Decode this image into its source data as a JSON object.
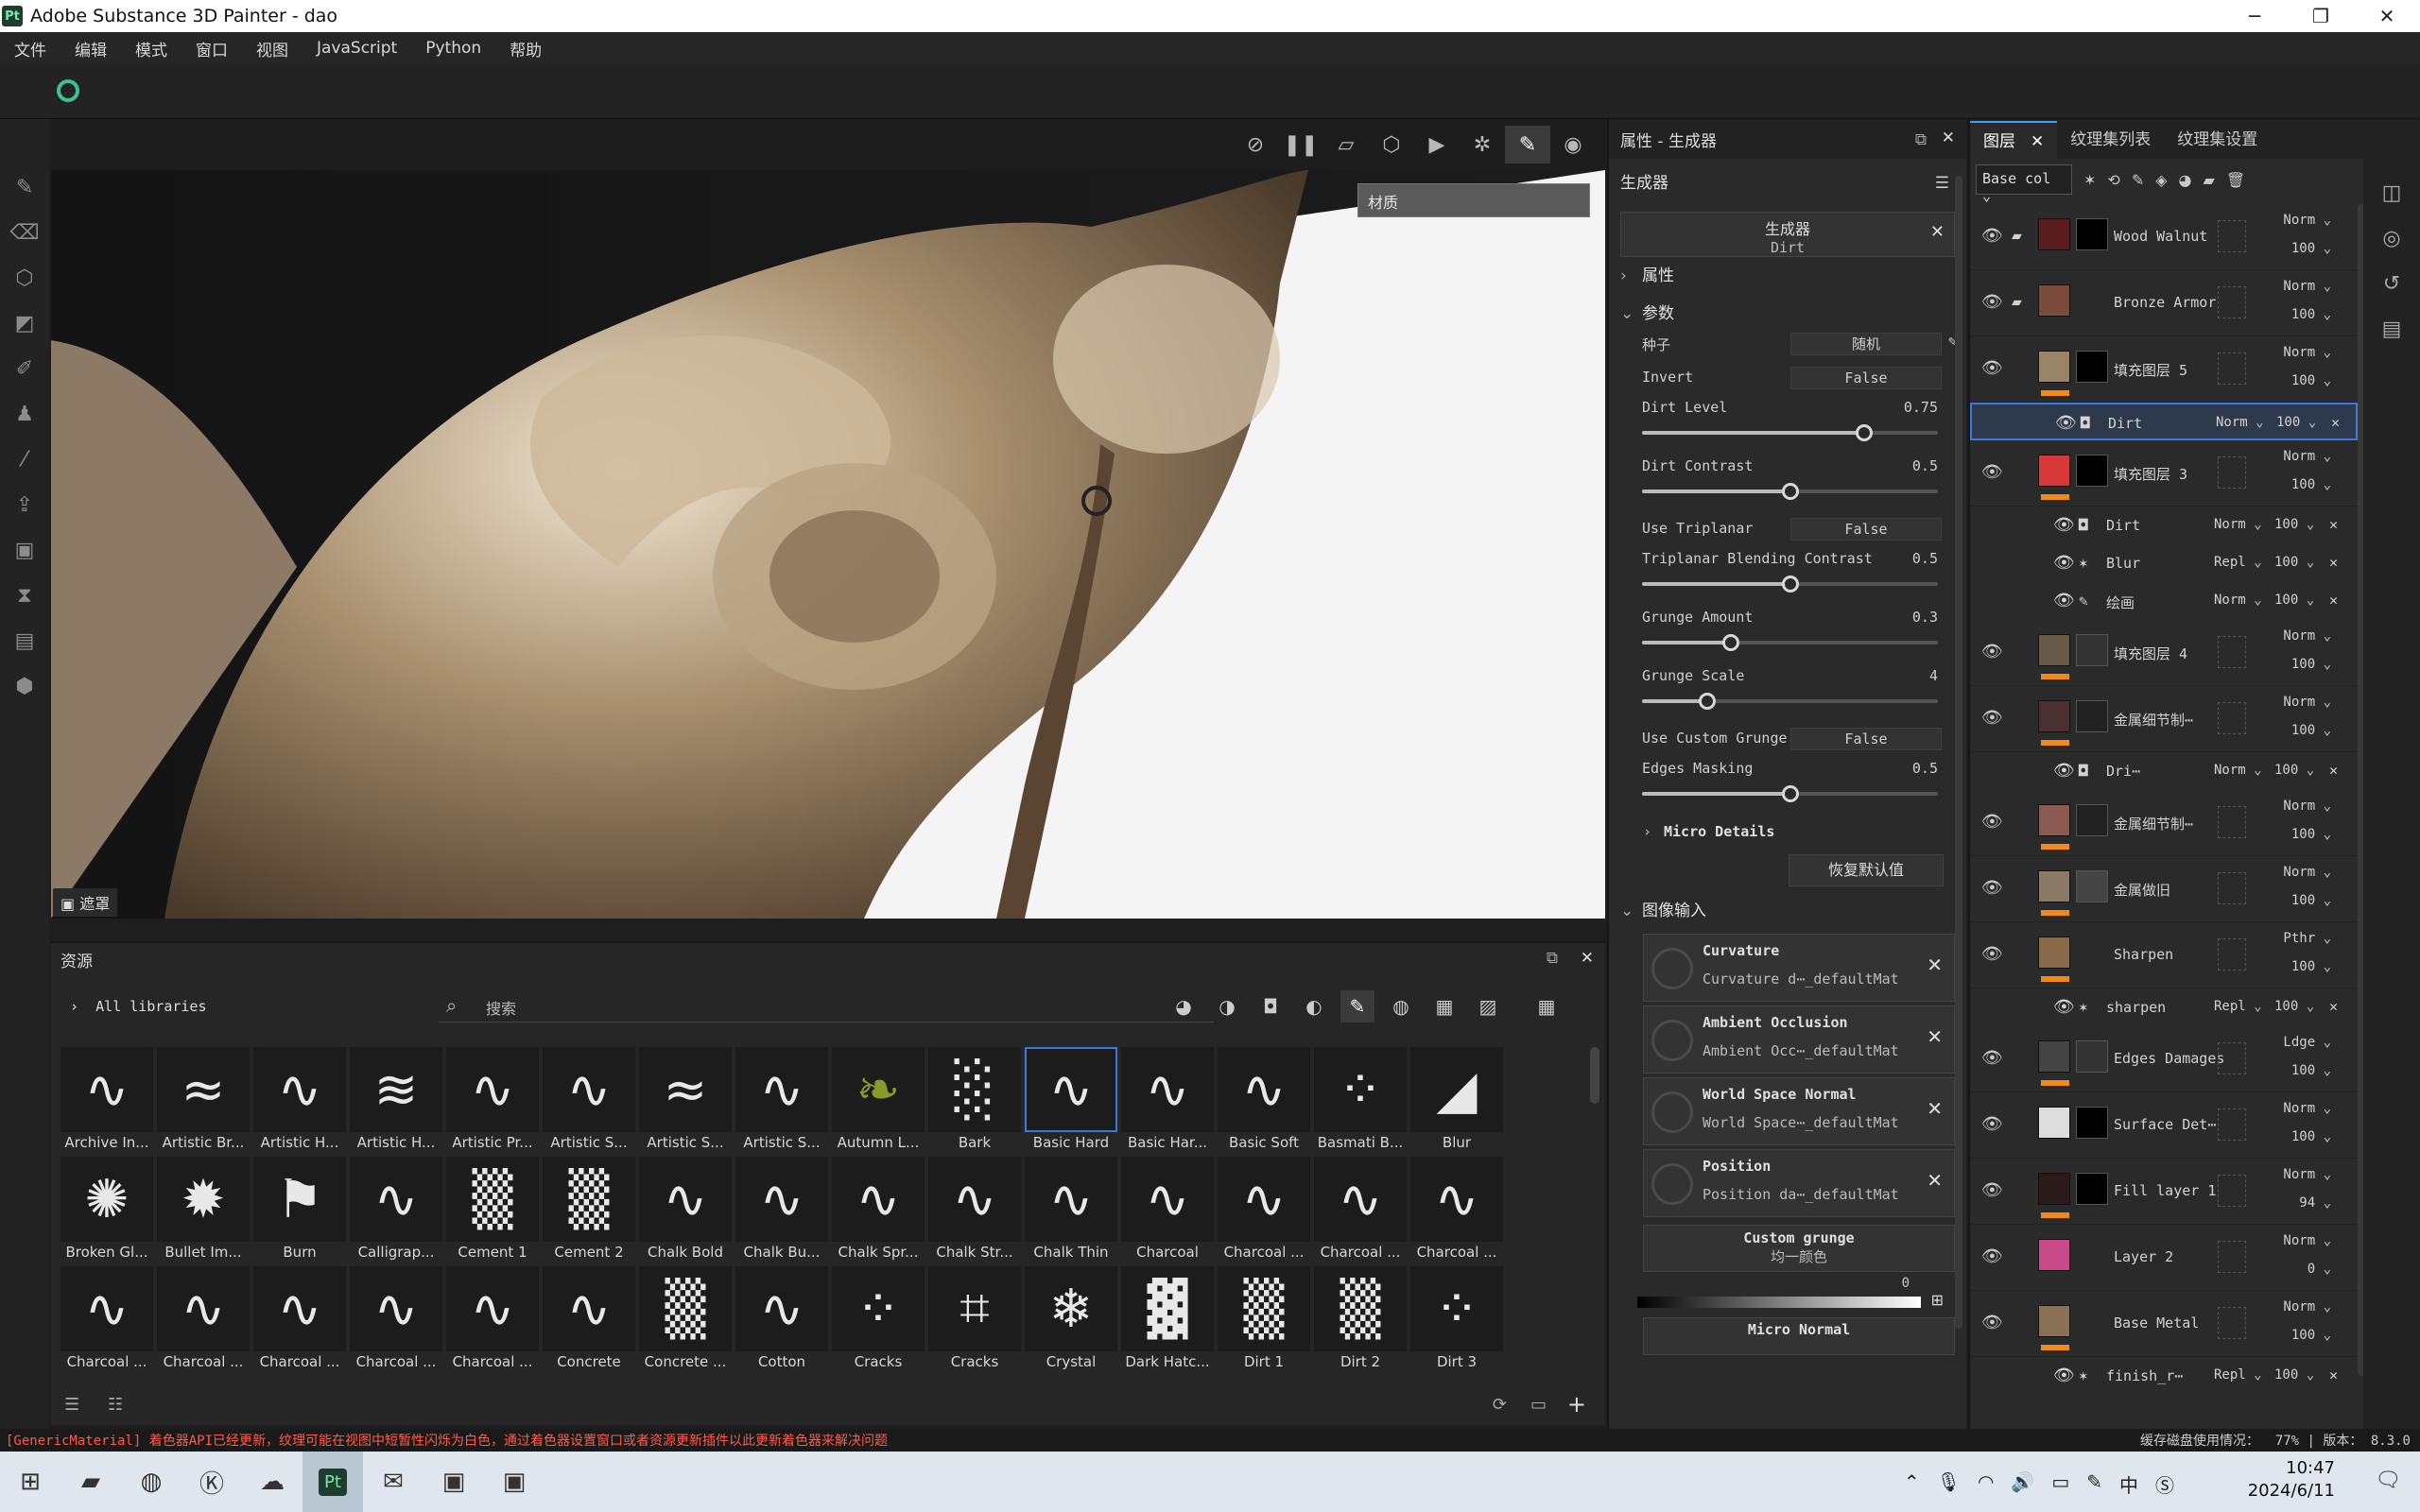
{
  "window": {
    "title": "Adobe Substance 3D Painter - dao",
    "app_icon": "Pt"
  },
  "menu": [
    "文件",
    "编辑",
    "模式",
    "窗口",
    "视图",
    "JavaScript",
    "Python",
    "帮助"
  ],
  "viewport": {
    "material_select": "材质",
    "mask_label": "遮罩"
  },
  "properties": {
    "header": "属性 - 生成器",
    "section_title": "生成器",
    "generator_card": {
      "title": "生成器",
      "subtitle": "Dirt"
    },
    "attr_section": "属性",
    "param_section": "参数",
    "seed": {
      "label": "种子",
      "value": "随机"
    },
    "invert": {
      "label": "Invert",
      "value": "False"
    },
    "dirt_level": {
      "label": "Dirt Level",
      "value": "0.75",
      "fraction": 0.75
    },
    "dirt_contrast": {
      "label": "Dirt Contrast",
      "value": "0.5",
      "fraction": 0.5
    },
    "use_triplanar": {
      "label": "Use Triplanar",
      "value": "False"
    },
    "triplanar_blend": {
      "label": "Triplanar Blending Contrast",
      "value": "0.5",
      "fraction": 0.5
    },
    "grunge_amount": {
      "label": "Grunge Amount",
      "value": "0.3",
      "fraction": 0.3
    },
    "grunge_scale": {
      "label": "Grunge Scale",
      "value": "4",
      "fraction": 0.22
    },
    "use_custom_grunge": {
      "label": "Use Custom Grunge",
      "value": "False"
    },
    "edges_masking": {
      "label": "Edges Masking",
      "value": "0.5",
      "fraction": 0.5
    },
    "micro_details": "Micro Details",
    "reset_button": "恢复默认值",
    "image_input_section": "图像输入",
    "image_inputs": [
      {
        "title": "Curvature",
        "sub": "Curvature d⋯_defaultMat"
      },
      {
        "title": "Ambient Occlusion",
        "sub": "Ambient Occ⋯_defaultMat"
      },
      {
        "title": "World Space Normal",
        "sub": "World Space⋯_defaultMat"
      },
      {
        "title": "Position",
        "sub": "Position da⋯_defaultMat"
      }
    ],
    "custom_grunge": {
      "title": "Custom grunge",
      "sub": "均一颜色",
      "value": "0"
    },
    "micro_normal": "Micro Normal"
  },
  "layers_panel": {
    "tabs": [
      "图层",
      "纹理集列表",
      "纹理集设置"
    ],
    "channel": "Base col",
    "layers": [
      {
        "name": "Wood Walnut",
        "blend": "Norm",
        "opacity": "100"
      },
      {
        "name": "Bronze Armor",
        "blend": "Norm",
        "opacity": "100"
      },
      {
        "name": "填充图层 5",
        "blend": "Norm",
        "opacity": "100"
      },
      {
        "name": "填充图层 3",
        "blend": "Norm",
        "opacity": "100"
      },
      {
        "name": "填充图层 4",
        "blend": "Norm",
        "opacity": "100"
      },
      {
        "name": "金属细节制⋯",
        "blend": "Norm",
        "opacity": "100"
      },
      {
        "name": "金属细节制⋯",
        "blend": "Norm",
        "opacity": "100"
      },
      {
        "name": "金属做旧",
        "blend": "Norm",
        "opacity": "100"
      },
      {
        "name": "Sharpen",
        "blend": "Pthr",
        "opacity": "100"
      },
      {
        "name": "Edges Damages",
        "blend": "Ldge",
        "opacity": "100"
      },
      {
        "name": "Surface Det⋯",
        "blend": "Norm",
        "opacity": "100"
      },
      {
        "name": "Fill layer 1",
        "blend": "Norm",
        "opacity": "94"
      },
      {
        "name": "Layer 2",
        "blend": "Norm",
        "opacity": "0"
      },
      {
        "name": "Base Metal",
        "blend": "Norm",
        "opacity": "100"
      }
    ],
    "effects": [
      {
        "name": "Dirt",
        "blend": "Norm",
        "opacity": "100"
      },
      {
        "name": "Dirt",
        "blend": "Norm",
        "opacity": "100"
      },
      {
        "name": "Blur",
        "blend": "Repl",
        "opacity": "100"
      },
      {
        "name": "绘画",
        "blend": "Norm",
        "opacity": "100"
      },
      {
        "name": "Dri⋯",
        "blend": "Norm",
        "opacity": "100"
      },
      {
        "name": "sharpen",
        "blend": "Repl",
        "opacity": "100"
      },
      {
        "name": "finish_r⋯",
        "blend": "Repl",
        "opacity": "100"
      }
    ]
  },
  "assets": {
    "title": "资源",
    "library": "All libraries",
    "search_placeholder": "搜索",
    "items": [
      "Archive In...",
      "Artistic Br...",
      "Artistic H...",
      "Artistic H...",
      "Artistic Pr...",
      "Artistic S...",
      "Artistic S...",
      "Artistic S...",
      "Autumn L...",
      "Bark",
      "Basic Hard",
      "Basic Har...",
      "Basic Soft",
      "Basmati B...",
      "Blur",
      "Broken Gl...",
      "Bullet Im...",
      "Burn",
      "Calligrap...",
      "Cement 1",
      "Cement 2",
      "Chalk Bold",
      "Chalk Bu...",
      "Chalk Spr...",
      "Chalk Str...",
      "Chalk Thin",
      "Charcoal",
      "Charcoal ...",
      "Charcoal ...",
      "Charcoal ...",
      "Charcoal ...",
      "Charcoal ...",
      "Charcoal ...",
      "Charcoal ...",
      "Charcoal ...",
      "Concrete",
      "Concrete ...",
      "Cotton",
      "Cracks",
      "Cracks",
      "Crystal",
      "Dark Hatc...",
      "Dirt 1",
      "Dirt 2",
      "Dirt 3"
    ]
  },
  "status": {
    "message": "[GenericMaterial] 着色器API已经更新，纹理可能在视图中短暂性闪烁为白色，通过着色器设置窗口或者资源更新插件以此更新着色器来解决问题",
    "cache": "缓存磁盘使用情况：",
    "cache_value": "77%",
    "version_label": "版本：",
    "version": "8.3.0"
  },
  "taskbar": {
    "time": "10:47",
    "date": "2024/6/11",
    "ime": "中"
  }
}
